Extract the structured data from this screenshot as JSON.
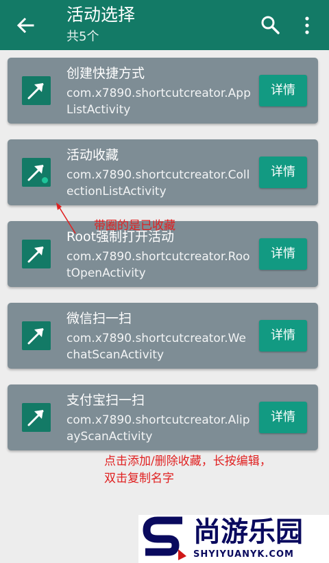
{
  "appbar": {
    "title": "活动选择",
    "subtitle": "共5个",
    "color": "#137a66"
  },
  "activities": [
    {
      "name": "创建快捷方式",
      "class": "com.x7890.shortcutcreator.AppListActivity",
      "button": "详情",
      "favorite": false
    },
    {
      "name": "活动收藏",
      "class": "com.x7890.shortcutcreator.CollectionListActivity",
      "button": "详情",
      "favorite": true
    },
    {
      "name": "Root强制打开活动",
      "class": "com.x7890.shortcutcreator.RootOpenActivity",
      "button": "详情",
      "favorite": false
    },
    {
      "name": "微信扫一扫",
      "class": "com.x7890.shortcutcreator.WechatScanActivity",
      "button": "详情",
      "favorite": false
    },
    {
      "name": "支付宝扫一扫",
      "class": "com.x7890.shortcutcreator.AlipayScanActivity",
      "button": "详情",
      "favorite": false
    }
  ],
  "annotations": {
    "favorite_note": "带圈的是已收藏",
    "usage_line1": "点击添加/删除收藏，长按编辑，",
    "usage_line2": "双击复制名字",
    "color": "#e02020"
  },
  "watermark": {
    "text": "尚游乐园",
    "url": "SHYIYUANYK.COM"
  }
}
